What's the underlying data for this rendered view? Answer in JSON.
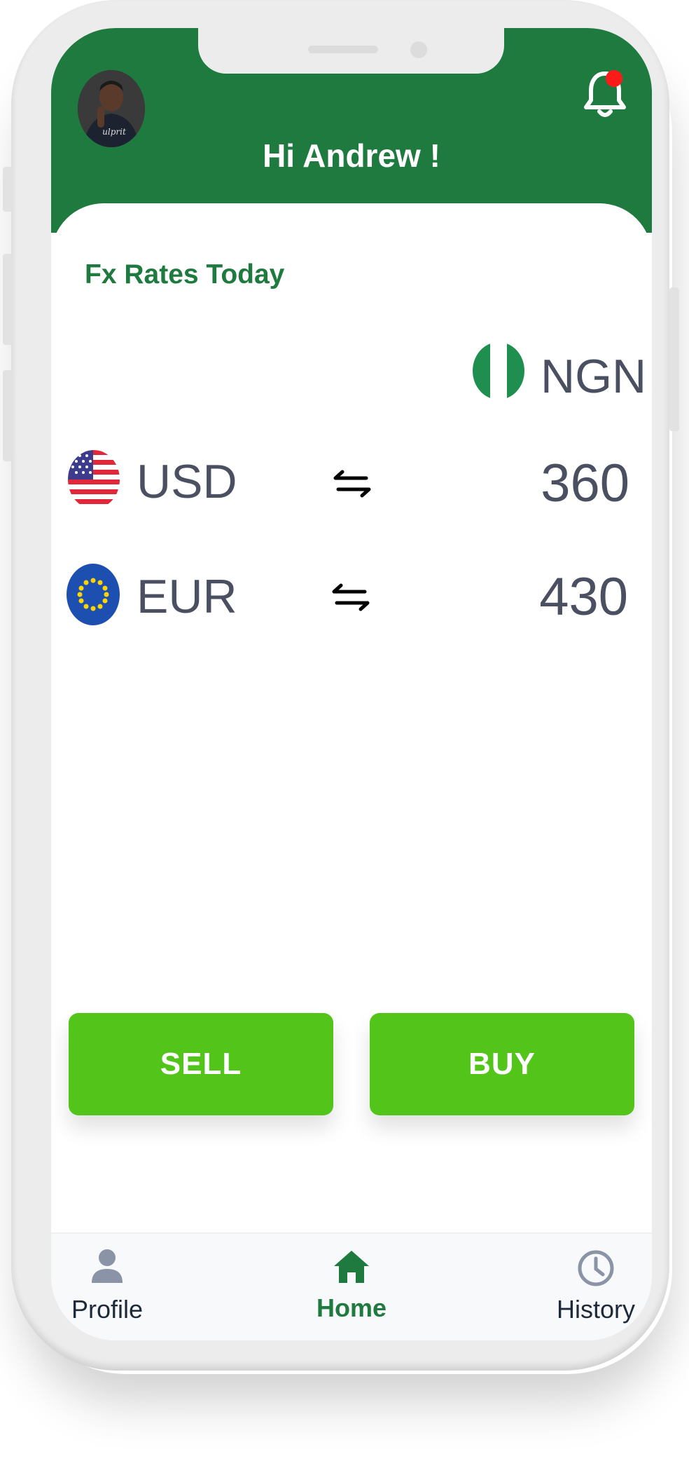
{
  "header": {
    "greeting": "Hi Andrew !",
    "avatar_shirt_text": "ulprit",
    "notification_dot": true
  },
  "rates": {
    "title": "Fx Rates Today",
    "base_currency": "NGN",
    "rows": [
      {
        "code": "USD",
        "rate": "360",
        "flag": "us-flag"
      },
      {
        "code": "EUR",
        "rate": "430",
        "flag": "eu-flag"
      }
    ]
  },
  "actions": {
    "sell": "SELL",
    "buy": "BUY"
  },
  "tabs": [
    {
      "label": "Profile",
      "icon": "person-icon",
      "active": false
    },
    {
      "label": "Home",
      "icon": "home-icon",
      "active": true
    },
    {
      "label": "History",
      "icon": "clock-icon",
      "active": false
    }
  ],
  "colors": {
    "brand_green": "#1f7a3f",
    "button_green": "#52c41a",
    "notification_red": "#ff1a1a",
    "text_gray": "#4a5061"
  }
}
